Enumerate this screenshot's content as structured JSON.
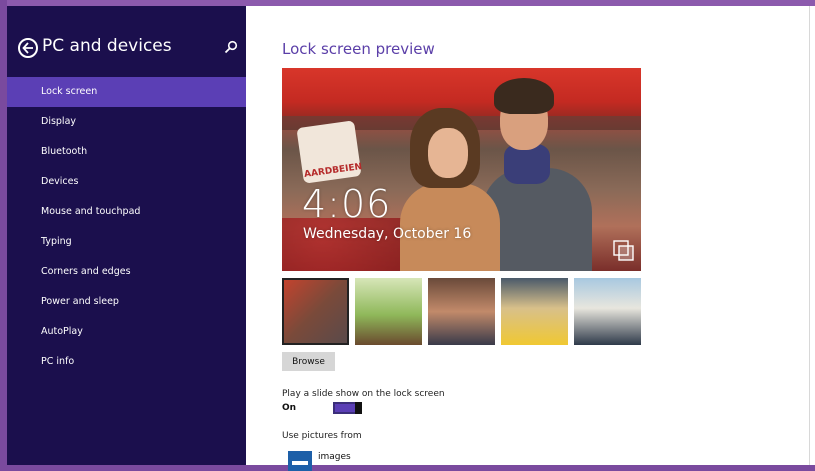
{
  "colors": {
    "sidebar_bg": "#1b0f4d",
    "sidebar_active": "#5b3fb5",
    "accent": "#5b3fa8",
    "toggle_on": "#5b3fb5"
  },
  "sidebar": {
    "title": "PC and devices",
    "back_icon": "back-arrow-icon",
    "search_icon": "search-icon",
    "items": [
      {
        "label": "Lock screen",
        "active": true
      },
      {
        "label": "Display"
      },
      {
        "label": "Bluetooth"
      },
      {
        "label": "Devices"
      },
      {
        "label": "Mouse and touchpad"
      },
      {
        "label": "Typing"
      },
      {
        "label": "Corners and edges"
      },
      {
        "label": "Power and sleep"
      },
      {
        "label": "AutoPlay"
      },
      {
        "label": "PC info"
      }
    ]
  },
  "main": {
    "title": "Lock screen preview",
    "preview": {
      "time": "4:06",
      "date": "Wednesday, October 16",
      "sign_text": "AARDBEIEN",
      "camera_icon": "camera-icon"
    },
    "thumbnails": [
      {
        "selected": true
      },
      {
        "selected": false
      },
      {
        "selected": false
      },
      {
        "selected": false
      },
      {
        "selected": false
      }
    ],
    "browse_label": "Browse",
    "slideshow": {
      "label": "Play a slide show on the lock screen",
      "state": "On",
      "enabled": true
    },
    "use_pictures": {
      "label": "Use pictures from",
      "folder_icon": "folder-icon",
      "folder": "images"
    }
  }
}
